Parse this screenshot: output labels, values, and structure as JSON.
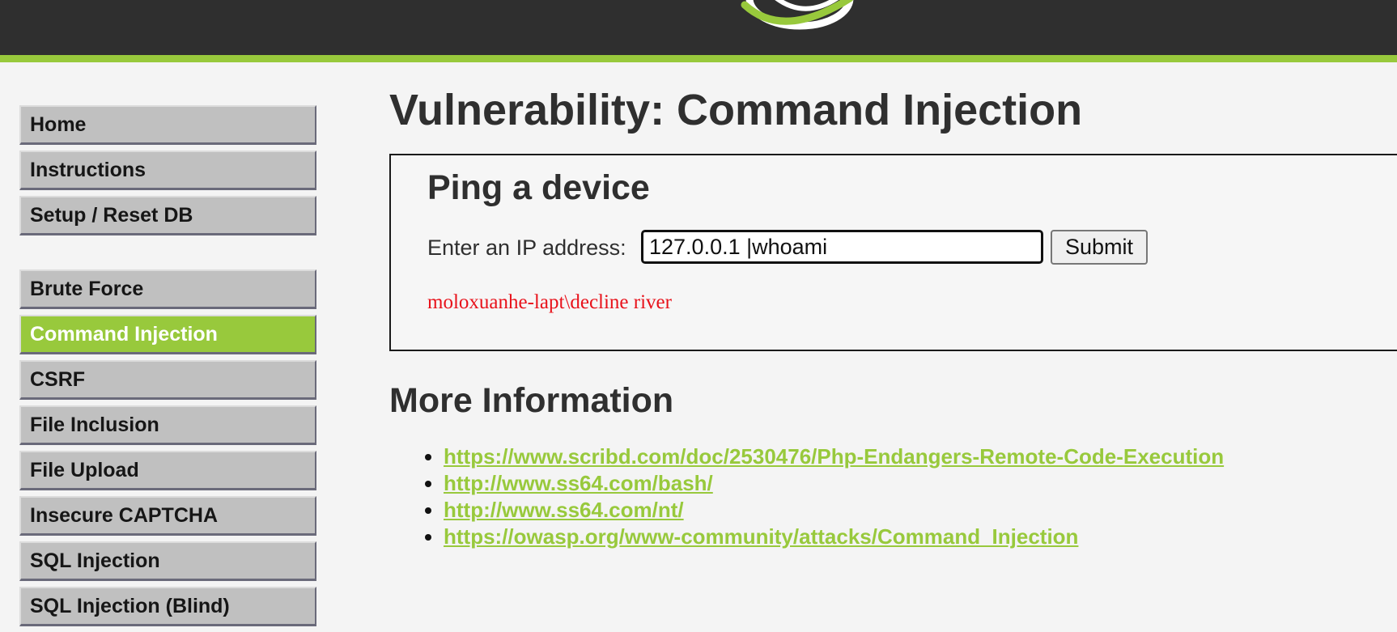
{
  "sidebar": {
    "group1": [
      "Home",
      "Instructions",
      "Setup / Reset DB"
    ],
    "group2": [
      "Brute Force",
      "Command Injection",
      "CSRF",
      "File Inclusion",
      "File Upload",
      "Insecure CAPTCHA",
      "SQL Injection",
      "SQL Injection (Blind)"
    ],
    "active": "Command Injection"
  },
  "main": {
    "title": "Vulnerability: Command Injection",
    "form": {
      "heading": "Ping a device",
      "ip_label": "Enter an IP address:",
      "ip_value": "127.0.0.1 |whoami",
      "submit_label": "Submit"
    },
    "output": "moloxuanhe-lapt\\decline river",
    "more_info": {
      "heading": "More Information",
      "links": [
        "https://www.scribd.com/doc/2530476/Php-Endangers-Remote-Code-Execution",
        "http://www.ss64.com/bash/",
        "http://www.ss64.com/nt/",
        "https://owasp.org/www-community/attacks/Command_Injection"
      ]
    }
  },
  "colors": {
    "accent": "#98c93c",
    "header_bg": "#2f2f2f",
    "output_text": "#e8121b",
    "menu_bg": "#c0c0c0"
  },
  "icons": {
    "logo": "dvwa-swoosh-logo"
  }
}
